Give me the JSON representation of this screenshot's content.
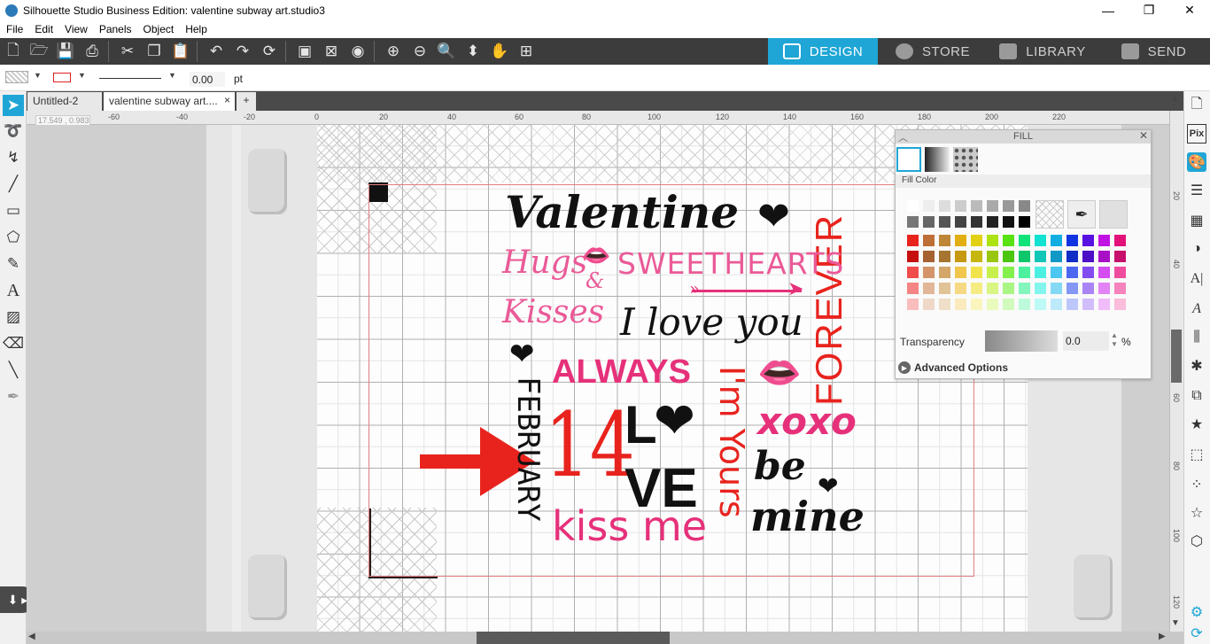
{
  "window": {
    "title": "Silhouette Studio Business Edition: valentine subway art.studio3",
    "controls": [
      "—",
      "❐",
      "✕"
    ]
  },
  "menu": [
    "File",
    "Edit",
    "View",
    "Panels",
    "Object",
    "Help"
  ],
  "nav_tabs": [
    {
      "label": "DESIGN",
      "active": true
    },
    {
      "label": "STORE",
      "active": false
    },
    {
      "label": "LIBRARY",
      "active": false
    },
    {
      "label": "SEND",
      "active": false
    }
  ],
  "properties": {
    "line_width_value": "0.00",
    "line_width_unit": "pt"
  },
  "doc_tabs": [
    {
      "label": "Untitled-2"
    },
    {
      "label": "valentine subway art...."
    }
  ],
  "doc_tab_close": "×",
  "doc_tab_add": "+",
  "ruler": {
    "coords": "17.549 , 0.983",
    "h_ticks": [
      "-60",
      "-40",
      "-20",
      "0",
      "20",
      "40",
      "60",
      "80",
      "100",
      "120",
      "140",
      "160",
      "180",
      "200",
      "220"
    ],
    "v_ticks": [
      "20",
      "40",
      "60",
      "80",
      "100",
      "120"
    ]
  },
  "artwork": {
    "valentine": "Valentine",
    "hugs": "Hugs",
    "amp": "&",
    "kisses": "Kisses",
    "sweethearts": "SWEETHEARTS",
    "love_you": "I love you",
    "forever": "FOREVER",
    "always": "ALWAYS",
    "february": "FEBRUARY",
    "fourteen": "14",
    "l": "L",
    "ve": "VE",
    "im_yours": "I'm Yours",
    "xoxo": "xoxo",
    "be": "be",
    "mine": "mine",
    "kiss_me": "kiss me"
  },
  "fill_panel": {
    "title": "FILL",
    "section": "Fill Color",
    "transparency_label": "Transparency",
    "transparency_value": "0.0",
    "transparency_unit": "%",
    "advanced": "Advanced Options"
  },
  "colors": {
    "accent": "#1fa6d6",
    "pink": "#e6317a",
    "red": "#e8231e",
    "light_pink": "#ea5a97"
  }
}
